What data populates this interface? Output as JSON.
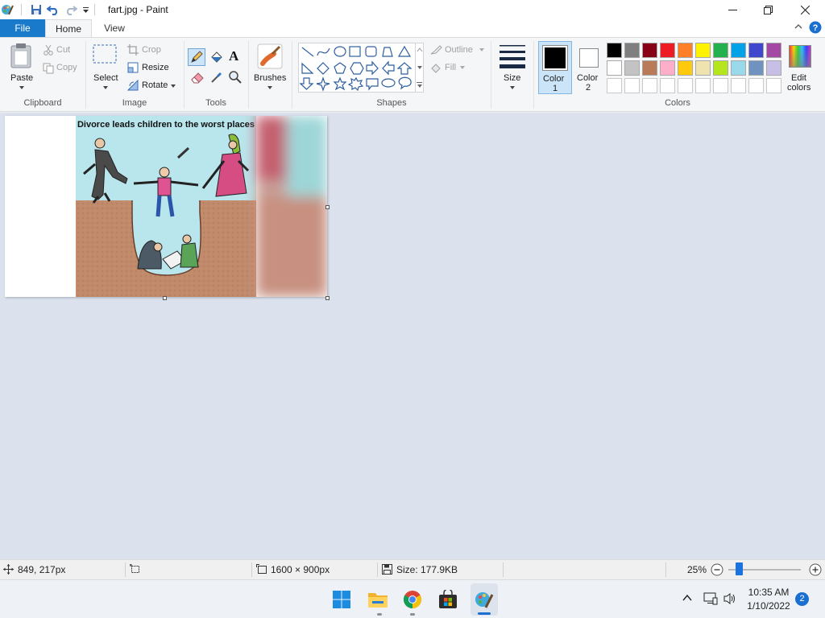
{
  "window": {
    "title": "fart.jpg - Paint",
    "minimize_label": "—",
    "maximize_label": "❐",
    "close_label": "✕"
  },
  "tabs": [
    {
      "label": "File"
    },
    {
      "label": "Home"
    },
    {
      "label": "View"
    }
  ],
  "ribbon": {
    "clipboard": {
      "paste": "Paste",
      "cut": "Cut",
      "copy": "Copy",
      "group": "Clipboard"
    },
    "image": {
      "select": "Select",
      "crop": "Crop",
      "resize": "Resize",
      "rotate": "Rotate",
      "group": "Image"
    },
    "tools": {
      "group": "Tools"
    },
    "brushes": {
      "label": "Brushes"
    },
    "shapes": {
      "outline": "Outline",
      "fill": "Fill",
      "group": "Shapes"
    },
    "size": {
      "label": "Size"
    },
    "color1": {
      "line1": "Color",
      "line2": "1"
    },
    "color2": {
      "line1": "Color",
      "line2": "2"
    },
    "edit_colors": {
      "line1": "Edit",
      "line2": "colors"
    },
    "colors_group": "Colors"
  },
  "colors": {
    "accent": "#1979ca",
    "color1": "#000000",
    "color2": "#ffffff",
    "palette_row1": [
      "#000000",
      "#7f7f7f",
      "#880015",
      "#ed1c24",
      "#ff7f27",
      "#fff200",
      "#22b14c",
      "#00a2e8",
      "#3f48cc",
      "#a349a4"
    ],
    "palette_row2": [
      "#ffffff",
      "#c3c3c3",
      "#b97a57",
      "#ffaec9",
      "#ffc90e",
      "#efe4b0",
      "#b5e61d",
      "#99d9ea",
      "#7092be",
      "#c8bfe7"
    ],
    "palette_row3": [
      "#ffffff",
      "#ffffff",
      "#ffffff",
      "#ffffff",
      "#ffffff",
      "#ffffff",
      "#ffffff",
      "#ffffff",
      "#ffffff",
      "#ffffff"
    ]
  },
  "canvas": {
    "cartoon_caption": "Divorce leads children to the worst places"
  },
  "status": {
    "cursor_pos": "849, 217px",
    "image_dimensions": "1600 × 900px",
    "file_size": "Size: 177.9KB",
    "zoom": "25%"
  },
  "taskbar": {
    "time": "10:35 AM",
    "date": "1/10/2022",
    "notification_count": "2"
  }
}
